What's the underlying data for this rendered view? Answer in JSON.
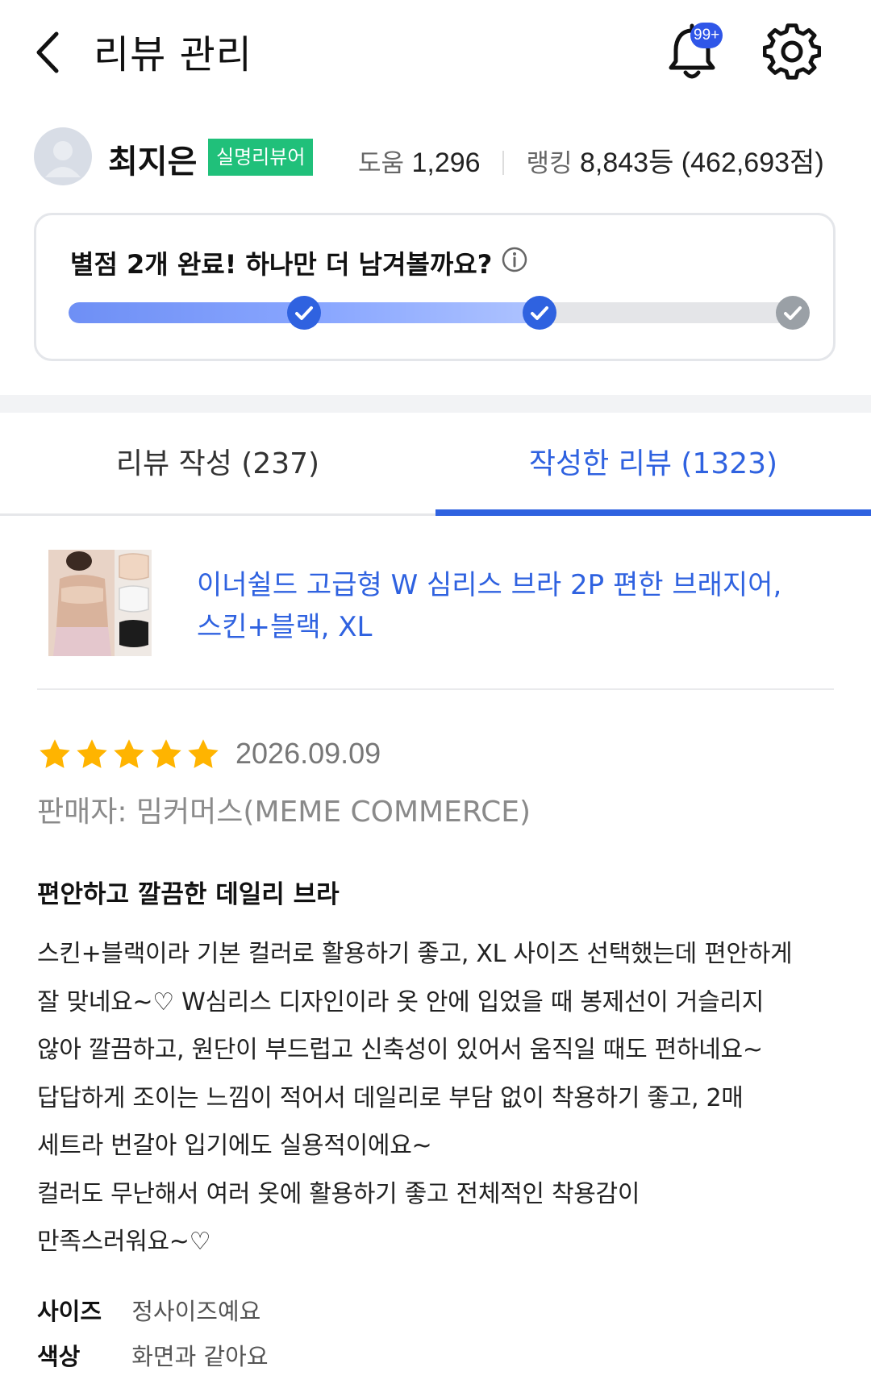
{
  "header": {
    "title": "리뷰 관리",
    "notification_badge": "99+"
  },
  "profile": {
    "name": "최지은",
    "badge": "실명리뷰어",
    "help_label": "도움",
    "help_count": "1,296",
    "rank_label": "랭킹",
    "rank_value": "8,843등 (462,693점)"
  },
  "progress": {
    "message": "별점 2개 완료! 하나만 더 남겨볼까요?",
    "completed_steps": 2,
    "total_steps": 3
  },
  "tabs": [
    {
      "label": "리뷰 작성 (237)",
      "active": false
    },
    {
      "label": "작성한 리뷰 (1323)",
      "active": true
    }
  ],
  "product": {
    "name_line1": "이너쉴드 고급형 W 심리스 브라 2P 편한 브래지어,",
    "name_line2": "스킨+블랙, XL"
  },
  "review": {
    "rating": 5,
    "date": "2026.09.09",
    "seller": "판매자: 밈커머스(MEME COMMERCE)",
    "title": "편안하고 깔끔한 데일리 브라",
    "body_lines": [
      "스킨+블랙이라 기본 컬러로 활용하기 좋고, XL 사이즈 선택했는데 편안하게",
      "잘 맞네요~♡ W심리스 디자인이라 옷 안에 입었을 때 봉제선이 거슬리지",
      "않아 깔끔하고, 원단이 부드럽고 신축성이 있어서 움직일 때도 편하네요~",
      "답답하게 조이는 느낌이 적어서 데일리로 부담 없이 착용하기 좋고, 2매",
      "세트라 번갈아 입기에도 실용적이에요~",
      "컬러도 무난해서 여러 옷에 활용하기 좋고 전체적인 착용감이",
      "만족스러워요~♡"
    ],
    "attributes": [
      {
        "label": "사이즈",
        "value": "정사이즈예요"
      },
      {
        "label": "색상",
        "value": "화면과 같아요"
      }
    ]
  },
  "colors": {
    "accent": "#2f62e0",
    "badge_green": "#20c07a",
    "star": "#ffb400"
  }
}
